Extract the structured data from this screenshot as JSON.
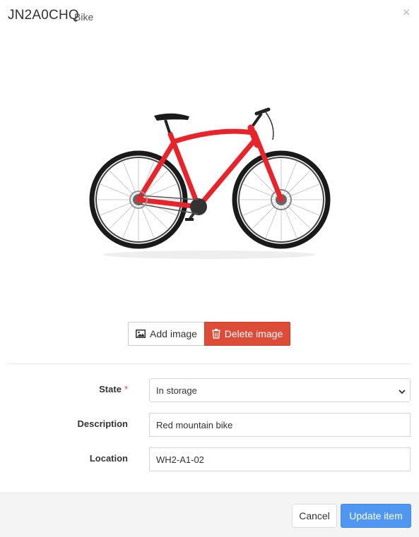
{
  "header": {
    "code": "JN2A0CHQ",
    "type": "Bike",
    "close_symbol": "×"
  },
  "image": {
    "subject": "red-bicycle",
    "frame_color": "#e8232a"
  },
  "image_buttons": {
    "add_label": "Add image",
    "delete_label": "Delete image",
    "add_icon": "image-icon",
    "delete_icon": "trash-icon"
  },
  "form": {
    "state": {
      "label": "State",
      "value": "In storage",
      "required": true
    },
    "description": {
      "label": "Description",
      "value": "Red mountain bike"
    },
    "location": {
      "label": "Location",
      "value": "WH2-A1-02"
    }
  },
  "footer": {
    "cancel_label": "Cancel",
    "update_label": "Update item"
  },
  "colors": {
    "delete": "#dd4b39",
    "primary": "#4f97f1",
    "required": "#dd4b39"
  }
}
